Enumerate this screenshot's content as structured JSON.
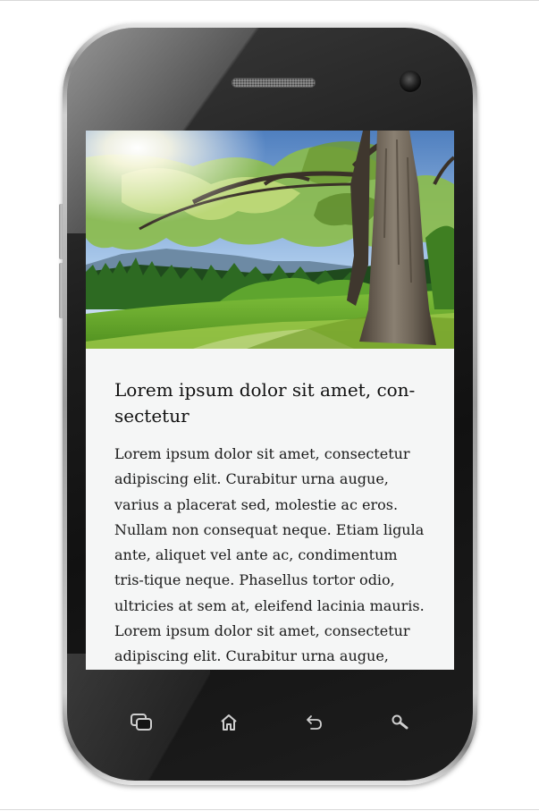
{
  "article": {
    "title": "Lorem ipsum dolor sit amet, con-\nsectetur",
    "paragraphs": [
      "Lorem ipsum dolor sit amet, consectetur adipiscing elit. Curabitur urna augue, varius a placerat sed, molestie ac eros. Nullam non consequat neque. Etiam ligula ante, aliquet vel ante ac, condimentum tris-tique neque. Phasellus tortor odio, ultricies at sem at, eleifend lacinia mauris.",
      "Lorem ipsum dolor sit amet, consectetur adipiscing elit. Curabitur urna augue, tique"
    ]
  },
  "navbar": {
    "buttons": [
      {
        "icon": "recent-apps-icon"
      },
      {
        "icon": "home-icon"
      },
      {
        "icon": "back-icon"
      },
      {
        "icon": "search-icon"
      }
    ]
  },
  "colors": {
    "screen_bg": "#f5f6f6",
    "bezel": "#151515",
    "nav_icon": "#cfcfcf"
  }
}
